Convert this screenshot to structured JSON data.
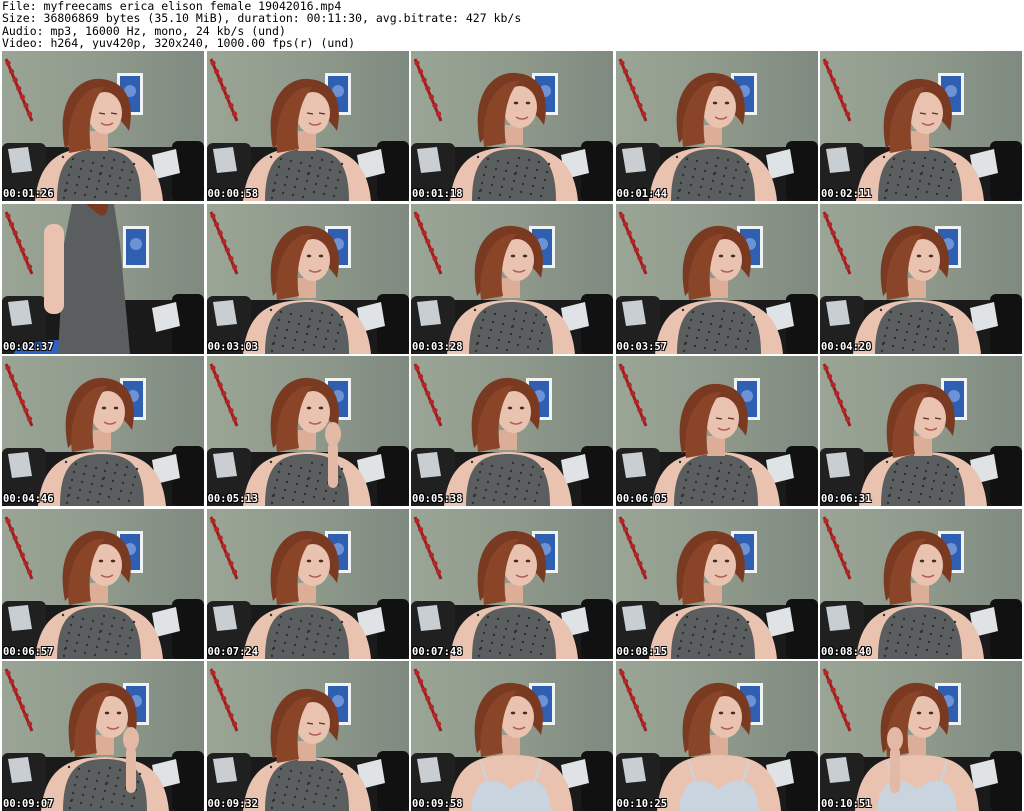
{
  "header": {
    "line1": "File: myfreecams_erica_elison_female_19042016.mp4",
    "line2": "Size: 36806869 bytes (35.10 MiB), duration: 00:11:30, avg.bitrate: 427 kb/s",
    "line3": "Audio: mp3, 16000 Hz, mono, 24 kb/s (und)",
    "line4": "Video: h264, yuv420p, 320x240, 1000.00 fps(r) (und)"
  },
  "thumbnails": [
    {
      "time": "00:01:26",
      "pose": "down"
    },
    {
      "time": "00:00:58",
      "pose": "down"
    },
    {
      "time": "00:01:18",
      "pose": "front"
    },
    {
      "time": "00:01:44",
      "pose": "front"
    },
    {
      "time": "00:02:11",
      "pose": "down"
    },
    {
      "time": "00:02:37",
      "pose": "standing"
    },
    {
      "time": "00:03:03",
      "pose": "front"
    },
    {
      "time": "00:03:28",
      "pose": "front"
    },
    {
      "time": "00:03:57",
      "pose": "front"
    },
    {
      "time": "00:04:20",
      "pose": "front"
    },
    {
      "time": "00:04:46",
      "pose": "front"
    },
    {
      "time": "00:05:13",
      "pose": "hand"
    },
    {
      "time": "00:05:38",
      "pose": "front"
    },
    {
      "time": "00:06:05",
      "pose": "down"
    },
    {
      "time": "00:06:31",
      "pose": "down"
    },
    {
      "time": "00:06:57",
      "pose": "front"
    },
    {
      "time": "00:07:24",
      "pose": "front"
    },
    {
      "time": "00:07:48",
      "pose": "front"
    },
    {
      "time": "00:08:15",
      "pose": "front"
    },
    {
      "time": "00:08:40",
      "pose": "front"
    },
    {
      "time": "00:09:07",
      "pose": "hand"
    },
    {
      "time": "00:09:32",
      "pose": "down"
    },
    {
      "time": "00:09:58",
      "pose": "bra"
    },
    {
      "time": "00:10:25",
      "pose": "bra"
    },
    {
      "time": "00:10:51",
      "pose": "bra-hand"
    }
  ],
  "colors": {
    "wall": "#8f9a8c",
    "couch": "#1a1a1a",
    "pillow": "#dfe3e6",
    "frame_blue": "#2f5fb0",
    "hair": "#7a3a22",
    "skin": "#e9c3b0",
    "blouse": "#5b5e5f",
    "bra": "#c9d4de"
  }
}
